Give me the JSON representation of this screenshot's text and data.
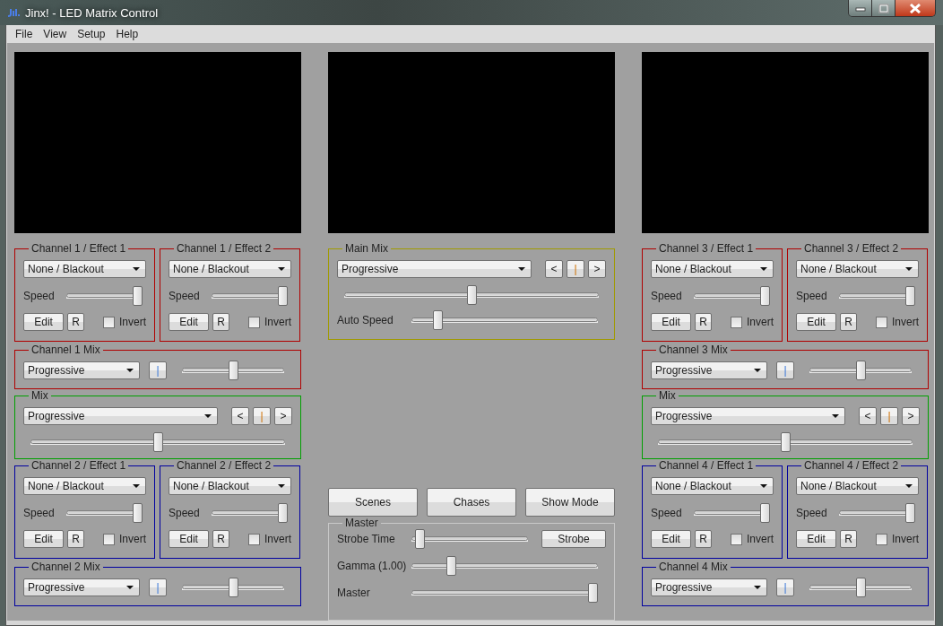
{
  "window": {
    "title": "Jinx! - LED Matrix Control"
  },
  "menu": [
    "File",
    "View",
    "Setup",
    "Help"
  ],
  "columns": [
    {
      "kind": "channels",
      "panels": [
        {
          "kind": "effects",
          "color": "#b00000",
          "effects": [
            {
              "title": "Channel 1 / Effect 1",
              "effect": "None / Blackout",
              "speed_label": "Speed",
              "level": 1.0,
              "edit": "Edit",
              "reset": "R",
              "invert": "Invert",
              "checked": false
            },
            {
              "title": "Channel 1 / Effect 2",
              "effect": "None / Blackout",
              "speed_label": "Speed",
              "level": 1.0,
              "edit": "Edit",
              "reset": "R",
              "invert": "Invert",
              "checked": false
            }
          ]
        },
        {
          "kind": "channel_mix",
          "title": "Channel 1 Mix",
          "color": "#b00000",
          "mode": "Progressive",
          "toggle": "|",
          "level": 0.5
        },
        {
          "kind": "mix",
          "title": "Mix",
          "color": "#00a000",
          "mode": "Progressive",
          "prev": "<",
          "toggle": "|",
          "next": ">",
          "level": 0.5
        },
        {
          "kind": "effects",
          "color": "#0000a0",
          "effects": [
            {
              "title": "Channel 2 / Effect 1",
              "effect": "None / Blackout",
              "speed_label": "Speed",
              "level": 1.0,
              "edit": "Edit",
              "reset": "R",
              "invert": "Invert",
              "checked": false
            },
            {
              "title": "Channel 2 / Effect 2",
              "effect": "None / Blackout",
              "speed_label": "Speed",
              "level": 1.0,
              "edit": "Edit",
              "reset": "R",
              "invert": "Invert",
              "checked": false
            }
          ]
        },
        {
          "kind": "channel_mix",
          "title": "Channel 2 Mix",
          "color": "#0000a0",
          "mode": "Progressive",
          "toggle": "|",
          "level": 0.5
        }
      ]
    },
    {
      "kind": "center",
      "main_mix": {
        "title": "Main Mix",
        "color": "#a09a00",
        "mode": "Progressive",
        "prev": "<",
        "toggle": "|",
        "next": ">",
        "level": 0.5,
        "auto_speed": {
          "label": "Auto Speed",
          "level": 0.12
        }
      },
      "buttons": [
        "Scenes",
        "Chases",
        "Show Mode"
      ],
      "master": {
        "title": "Master",
        "color": "#c8c8c8",
        "rows": [
          {
            "label": "Strobe Time",
            "level": 0.03,
            "button": "Strobe"
          },
          {
            "label": "Gamma (1.00)",
            "level": 0.2
          },
          {
            "label": "Master",
            "level": 1.0
          }
        ]
      }
    },
    {
      "kind": "channels",
      "panels": [
        {
          "kind": "effects",
          "color": "#b00000",
          "effects": [
            {
              "title": "Channel 3 / Effect 1",
              "effect": "None / Blackout",
              "speed_label": "Speed",
              "level": 1.0,
              "edit": "Edit",
              "reset": "R",
              "invert": "Invert",
              "checked": false
            },
            {
              "title": "Channel 3 / Effect 2",
              "effect": "None / Blackout",
              "speed_label": "Speed",
              "level": 1.0,
              "edit": "Edit",
              "reset": "R",
              "invert": "Invert",
              "checked": false
            }
          ]
        },
        {
          "kind": "channel_mix",
          "title": "Channel 3 Mix",
          "color": "#b00000",
          "mode": "Progressive",
          "toggle": "|",
          "level": 0.5
        },
        {
          "kind": "mix",
          "title": "Mix",
          "color": "#00a000",
          "mode": "Progressive",
          "prev": "<",
          "toggle": "|",
          "next": ">",
          "level": 0.5
        },
        {
          "kind": "effects",
          "color": "#0000a0",
          "effects": [
            {
              "title": "Channel 4 / Effect 1",
              "effect": "None / Blackout",
              "speed_label": "Speed",
              "level": 1.0,
              "edit": "Edit",
              "reset": "R",
              "invert": "Invert",
              "checked": false
            },
            {
              "title": "Channel 4 / Effect 2",
              "effect": "None / Blackout",
              "speed_label": "Speed",
              "level": 1.0,
              "edit": "Edit",
              "reset": "R",
              "invert": "Invert",
              "checked": false
            }
          ]
        },
        {
          "kind": "channel_mix",
          "title": "Channel 4 Mix",
          "color": "#0000a0",
          "mode": "Progressive",
          "toggle": "|",
          "level": 0.5
        }
      ]
    }
  ]
}
